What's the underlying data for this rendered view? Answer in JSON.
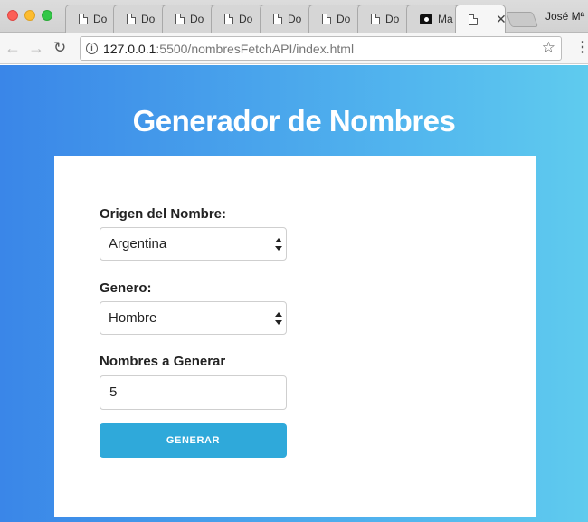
{
  "browser": {
    "tabs": [
      {
        "label": "Do",
        "icon": "document-icon"
      },
      {
        "label": "Do",
        "icon": "document-icon"
      },
      {
        "label": "Do",
        "icon": "document-icon"
      },
      {
        "label": "Do",
        "icon": "document-icon"
      },
      {
        "label": "Do",
        "icon": "document-icon"
      },
      {
        "label": "Do",
        "icon": "document-icon"
      },
      {
        "label": "Do",
        "icon": "document-icon"
      },
      {
        "label": "Ma",
        "icon": "camera-icon"
      },
      {
        "label": "",
        "icon": "document-icon",
        "active": true
      }
    ],
    "profile_name": "José Mª",
    "url_host": "127.0.0.1",
    "url_rest": ":5500/nombresFetchAPI/index.html"
  },
  "page": {
    "title": "Generador de Nombres",
    "origin_label": "Origen del Nombre:",
    "origin_value": "Argentina",
    "gender_label": "Genero:",
    "gender_value": "Hombre",
    "count_label": "Nombres a Generar",
    "count_value": "5",
    "generate_button": "GENERAR"
  },
  "colors": {
    "gradient_start": "#3a86e8",
    "gradient_end": "#5fcbee",
    "button": "#2fa9da"
  }
}
